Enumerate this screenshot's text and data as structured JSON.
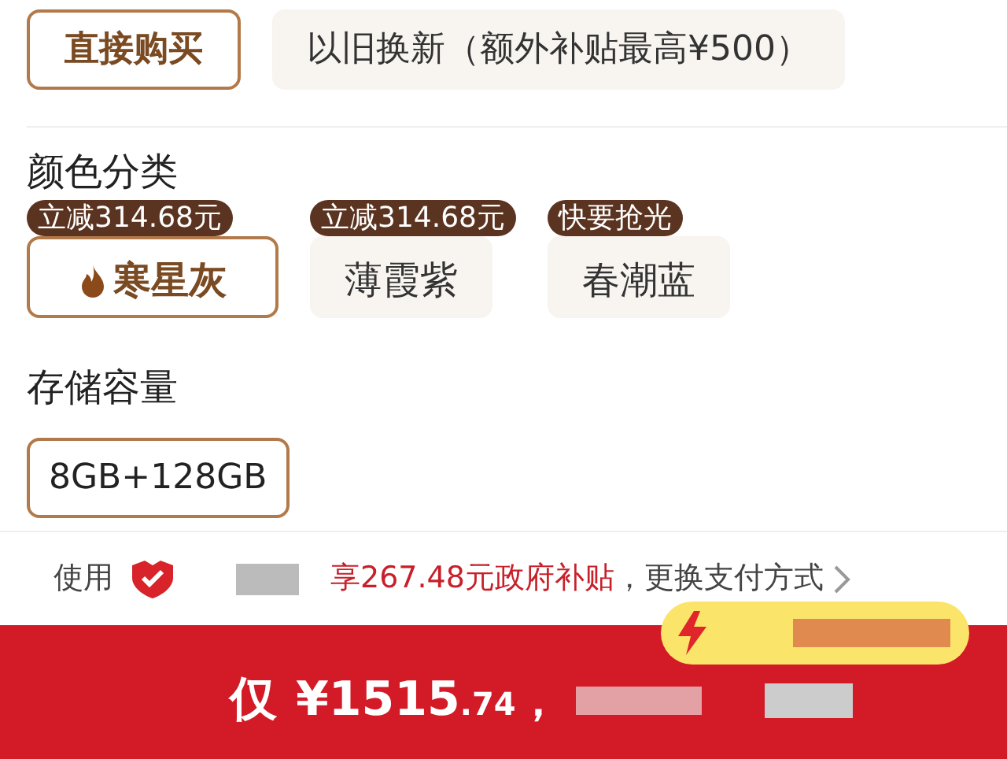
{
  "purchase_modes": [
    {
      "label": "直接购买",
      "selected": true
    },
    {
      "label": "以旧换新（额外补贴最高¥500）",
      "selected": false
    }
  ],
  "color_section": {
    "title": "颜色分类",
    "options": [
      {
        "label": "寒星灰",
        "badge": "立减314.68元",
        "selected": true,
        "hot": true
      },
      {
        "label": "薄霞紫",
        "badge": "立减314.68元",
        "selected": false,
        "hot": false
      },
      {
        "label": "春潮蓝",
        "badge": "快要抢光",
        "selected": false,
        "hot": false
      }
    ]
  },
  "storage_section": {
    "title": "存储容量",
    "options": [
      {
        "label": "8GB+128GB",
        "selected": true
      }
    ]
  },
  "payment_notice": {
    "prefix": "使用",
    "subsidy": "享267.48元政府补贴",
    "suffix": "，更换支付方式"
  },
  "buy_bar": {
    "prefix": "仅",
    "price": "¥1515",
    "decimals": ".74",
    "separator": "，"
  }
}
